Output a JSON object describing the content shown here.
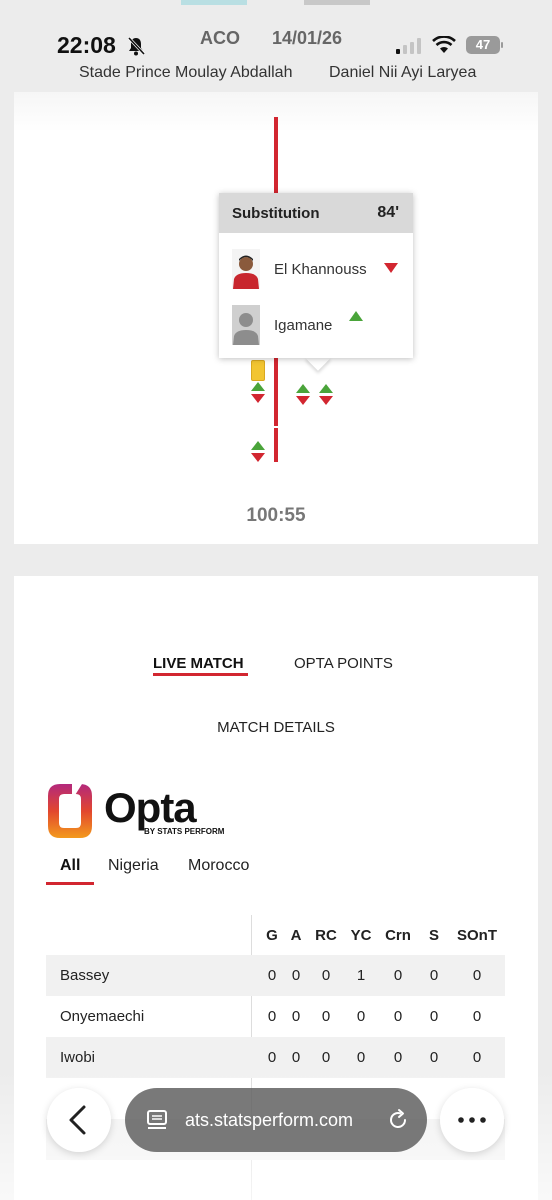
{
  "status_bar": {
    "time": "22:08",
    "battery": "47"
  },
  "match_header": {
    "competition": "ACO",
    "date": "14/01/26",
    "venue": "Stade Prince Moulay Abdallah",
    "referee": "Daniel Nii Ayi Laryea"
  },
  "timeline": {
    "elapsed": "100:55",
    "popup": {
      "title": "Substitution",
      "minute": "84'",
      "player_off": "El Khannouss",
      "player_on": "Igamane"
    }
  },
  "tabs": {
    "live_match": "LIVE MATCH",
    "opta_points": "OPTA POINTS",
    "match_details": "MATCH DETAILS"
  },
  "opta": {
    "word": "Opta",
    "byline": "BY STATS PERFORM"
  },
  "team_filter": [
    "All",
    "Nigeria",
    "Morocco"
  ],
  "stats_table": {
    "columns": [
      "G",
      "A",
      "RC",
      "YC",
      "Crn",
      "S",
      "SOnT"
    ],
    "rows": [
      {
        "name": "Bassey",
        "values": [
          "0",
          "0",
          "0",
          "1",
          "0",
          "0",
          "0"
        ]
      },
      {
        "name": "Onyemaechi",
        "values": [
          "0",
          "0",
          "0",
          "0",
          "0",
          "0",
          "0"
        ]
      },
      {
        "name": "Iwobi",
        "values": [
          "0",
          "0",
          "0",
          "0",
          "0",
          "0",
          "0"
        ]
      }
    ]
  },
  "browser": {
    "url": "ats.statsperform.com"
  },
  "colors": {
    "accent_red": "#d22630",
    "sub_on_green": "#4aa43a",
    "yellow_card": "#f2c531"
  }
}
